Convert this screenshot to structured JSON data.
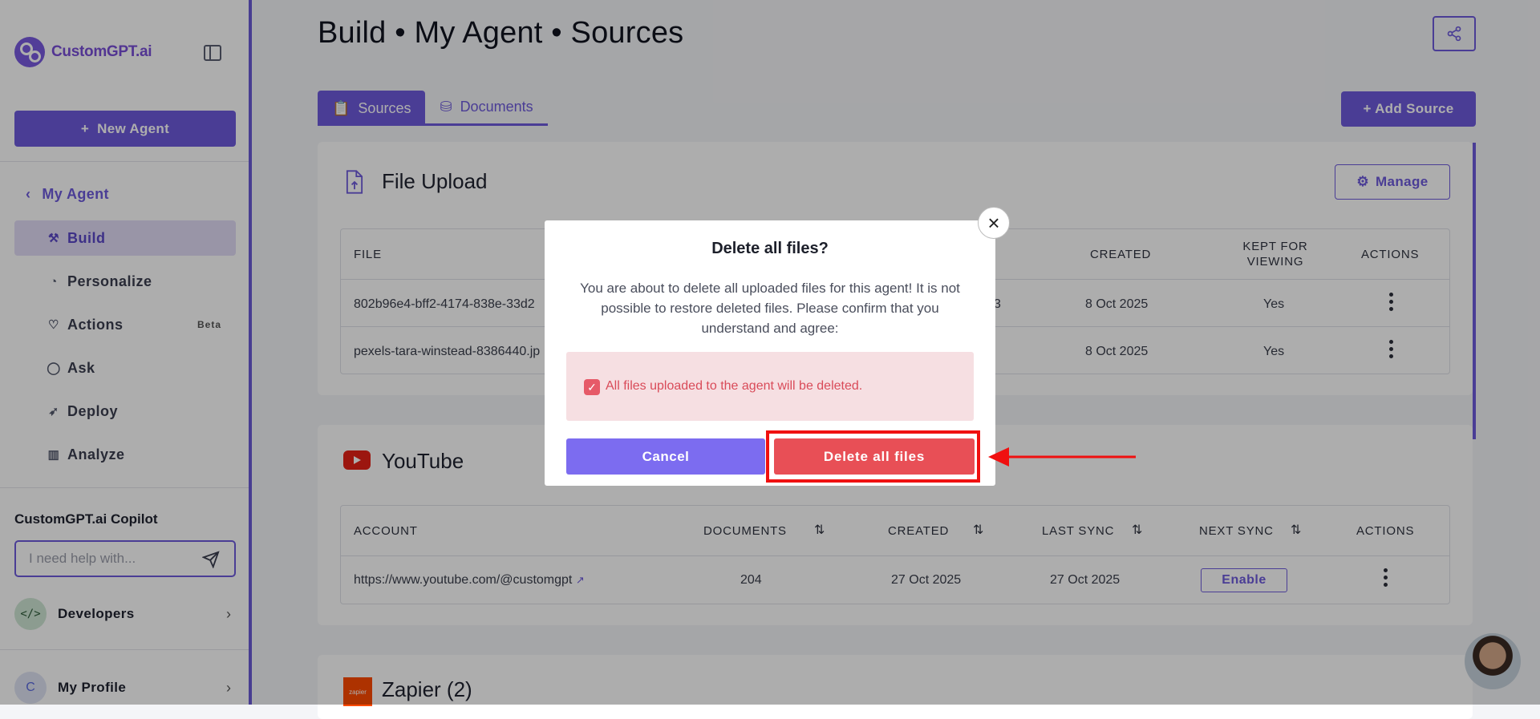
{
  "sidebar": {
    "logo_text": "CustomGPT.ai",
    "new_agent_label": "New Agent",
    "back_label": "My Agent",
    "items": [
      {
        "label": "Build",
        "icon": "hammer-icon"
      },
      {
        "label": "Personalize",
        "icon": "palette-icon"
      },
      {
        "label": "Actions",
        "icon": "actions-icon",
        "badge": "Beta"
      },
      {
        "label": "Ask",
        "icon": "chat-bubble-icon"
      },
      {
        "label": "Deploy",
        "icon": "rocket-icon"
      },
      {
        "label": "Analyze",
        "icon": "bar-chart-icon"
      }
    ],
    "copilot_title": "CustomGPT.ai Copilot",
    "copilot_placeholder": "I need help with...",
    "developers_label": "Developers",
    "profile_label": "My Profile",
    "profile_initial": "C"
  },
  "header": {
    "title": "Build • My Agent • Sources"
  },
  "tabs": [
    {
      "label": "Sources",
      "active": true
    },
    {
      "label": "Documents",
      "active": false
    }
  ],
  "add_source_label": "+ Add Source",
  "file_upload": {
    "title": "File Upload",
    "manage_label": "Manage",
    "columns": [
      "FILE",
      "CREATED",
      "KEPT FOR VIEWING",
      "ACTIONS"
    ],
    "rows": [
      {
        "file": "802b96e4-bff2-4174-838e-33d2",
        "partial": "3",
        "created": "8 Oct 2025",
        "kept": "Yes"
      },
      {
        "file": "pexels-tara-winstead-8386440.jp",
        "created": "8 Oct 2025",
        "kept": "Yes"
      }
    ]
  },
  "youtube": {
    "title": "YouTube",
    "columns": [
      "ACCOUNT",
      "DOCUMENTS",
      "CREATED",
      "LAST SYNC",
      "NEXT SYNC",
      "ACTIONS"
    ],
    "rows": [
      {
        "account": "https://www.youtube.com/@customgpt",
        "documents": "204",
        "created": "27 Oct 2025",
        "last_sync": "27 Oct 2025",
        "next_sync_button": "Enable"
      }
    ]
  },
  "zapier": {
    "title": "Zapier (2)",
    "logo_text": "zapier"
  },
  "modal": {
    "title": "Delete all files?",
    "message": "You are about to delete all uploaded files for this agent! It is not possible to restore deleted files. Please confirm that you understand and agree:",
    "checkbox_label": "All files uploaded to the agent will be deleted.",
    "checkbox_checked": true,
    "cancel_label": "Cancel",
    "delete_label": "Delete all files"
  },
  "colors": {
    "accent": "#6e5bdc",
    "danger": "#e84f56",
    "annotation": "#f01010"
  }
}
